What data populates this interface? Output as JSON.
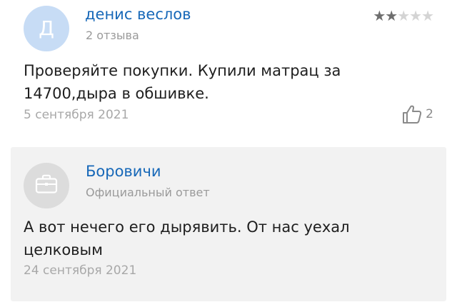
{
  "review": {
    "author": {
      "initial": "Д",
      "name": "денис веслов",
      "reviews_count": "2 отзыва"
    },
    "rating": {
      "value": 2,
      "max": 5
    },
    "text": "Проверяйте покупки. Купили матрац за 14700,дыра в обшивке.",
    "date": "5 сентября 2021",
    "likes": "2"
  },
  "reply": {
    "org_name": "Боровичи",
    "label": "Официальный ответ",
    "text": "А вот нечего его дырявить. От нас уехал целковым",
    "date": "24 сентября 2021"
  },
  "icons": {
    "like": "thumbs-up-icon",
    "org": "briefcase-icon",
    "star": "star-icon"
  },
  "colors": {
    "link": "#1768b8",
    "muted": "#a8a8a8",
    "avatar_bg": "#c7dcf5",
    "reply_bg": "#f2f2f2",
    "star_filled": "#6e6e6e",
    "star_empty": "#d4d4d4"
  }
}
